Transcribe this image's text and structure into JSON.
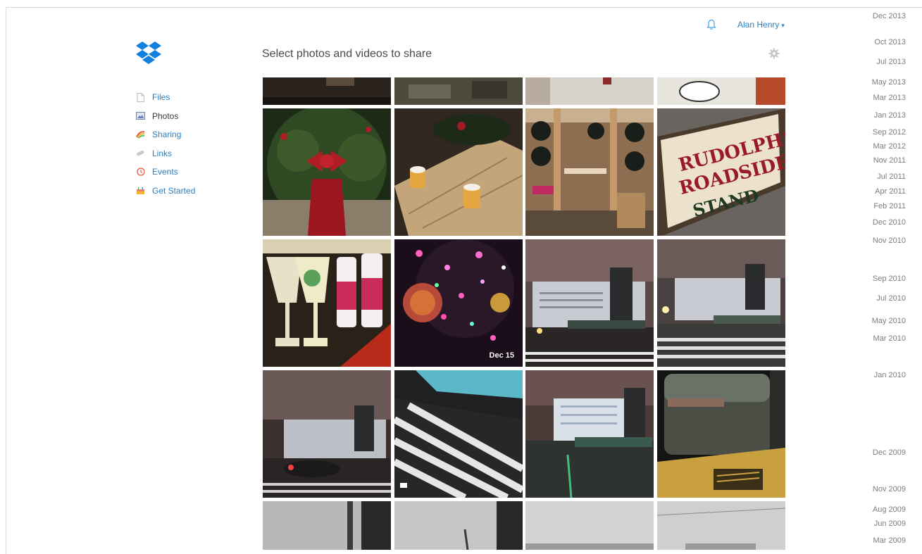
{
  "header": {
    "page_title": "Select photos and videos to share",
    "user_name": "Alan Henry",
    "bell_icon": "bell-icon",
    "gear_icon": "gear-icon",
    "caret_glyph": "▾"
  },
  "sidebar": {
    "logo_icon": "dropbox-logo-icon",
    "items": [
      {
        "label": "Files",
        "icon": "file-icon"
      },
      {
        "label": "Photos",
        "icon": "photo-icon"
      },
      {
        "label": "Sharing",
        "icon": "sharing-icon"
      },
      {
        "label": "Links",
        "icon": "link-icon"
      },
      {
        "label": "Events",
        "icon": "clock-icon"
      },
      {
        "label": "Get Started",
        "icon": "cake-icon"
      }
    ]
  },
  "grid": {
    "badge_text": "Dec 15"
  },
  "timeline": [
    "Dec 2013",
    "Oct 2013",
    "Jul 2013",
    "May 2013",
    "Mar 2013",
    "Jan 2013",
    "Sep 2012",
    "Mar 2012",
    "Nov 2011",
    "Jul 2011",
    "Apr 2011",
    "Feb 2011",
    "Dec 2010",
    "Nov 2010",
    "Sep 2010",
    "Jul 2010",
    "May 2010",
    "Mar 2010",
    "Jan 2010",
    "Dec 2009",
    "Nov 2009",
    "Aug 2009",
    "Jun 2009",
    "Mar 2009"
  ],
  "colors": {
    "accent": "#2a7fc2",
    "dropbox_blue": "#1081de",
    "timeline_text": "#7c7c7c"
  }
}
